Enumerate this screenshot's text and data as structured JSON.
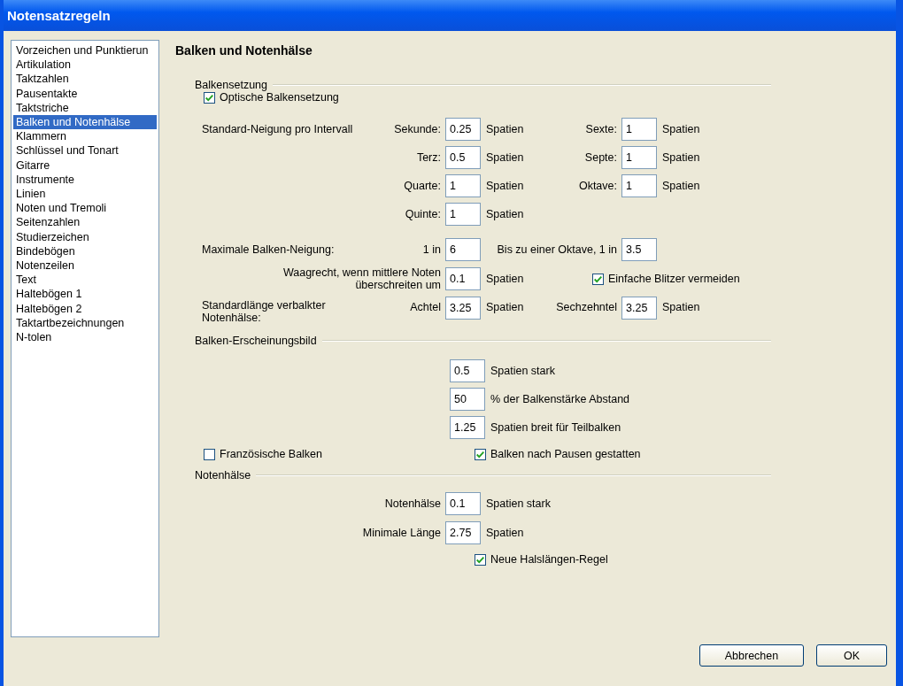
{
  "window": {
    "title": "Notensatzregeln"
  },
  "categories": [
    {
      "label": "Vorzeichen und Punktierun",
      "selected": false
    },
    {
      "label": "Artikulation",
      "selected": false
    },
    {
      "label": "Taktzahlen",
      "selected": false
    },
    {
      "label": "Pausentakte",
      "selected": false
    },
    {
      "label": "Taktstriche",
      "selected": false
    },
    {
      "label": "Balken und Notenhälse",
      "selected": true
    },
    {
      "label": "Klammern",
      "selected": false
    },
    {
      "label": "Schlüssel und Tonart",
      "selected": false
    },
    {
      "label": "Gitarre",
      "selected": false
    },
    {
      "label": "Instrumente",
      "selected": false
    },
    {
      "label": "Linien",
      "selected": false
    },
    {
      "label": "Noten und Tremoli",
      "selected": false
    },
    {
      "label": "Seitenzahlen",
      "selected": false
    },
    {
      "label": "Studierzeichen",
      "selected": false
    },
    {
      "label": "Bindebögen",
      "selected": false
    },
    {
      "label": "Notenzeilen",
      "selected": false
    },
    {
      "label": "Text",
      "selected": false
    },
    {
      "label": "Haltebögen 1",
      "selected": false
    },
    {
      "label": "Haltebögen 2",
      "selected": false
    },
    {
      "label": "Taktartbezeichnungen",
      "selected": false
    },
    {
      "label": "N-tolen",
      "selected": false
    }
  ],
  "page_title": "Balken und Notenhälse",
  "beaming": {
    "title": "Balkensetzung",
    "optical": {
      "label": "Optische Balkensetzung",
      "checked": true
    },
    "slope_label": "Standard-Neigung pro Intervall",
    "intervals_left": [
      {
        "label": "Sekunde:",
        "value": "0.25",
        "unit": "Spatien"
      },
      {
        "label": "Terz:",
        "value": "0.5",
        "unit": "Spatien"
      },
      {
        "label": "Quarte:",
        "value": "1",
        "unit": "Spatien"
      },
      {
        "label": "Quinte:",
        "value": "1",
        "unit": "Spatien"
      }
    ],
    "intervals_right": [
      {
        "label": "Sexte:",
        "value": "1",
        "unit": "Spatien"
      },
      {
        "label": "Septe:",
        "value": "1",
        "unit": "Spatien"
      },
      {
        "label": "Oktave:",
        "value": "1",
        "unit": "Spatien"
      }
    ],
    "max_slope": {
      "label": "Maximale Balken-Neigung:",
      "ratio_label": "1 in",
      "value": "6",
      "octave_label": "Bis zu einer Oktave, 1 in",
      "octave_value": "3.5"
    },
    "horizontal": {
      "label": "Waagrecht, wenn mittlere Noten überschreiten um",
      "value": "0.1",
      "unit": "Spatien"
    },
    "avoid_wedges": {
      "label": "Einfache Blitzer vermeiden",
      "checked": true
    },
    "stem_length": {
      "label": "Standardlänge verbalkter Notenhälse:",
      "eighth_label": "Achtel",
      "eighth_value": "3.25",
      "eighth_unit": "Spatien",
      "sixteenth_label": "Sechzehntel",
      "sixteenth_value": "3.25",
      "sixteenth_unit": "Spatien"
    }
  },
  "appearance": {
    "title": "Balken-Erscheinungsbild",
    "rows": [
      {
        "value": "0.5",
        "unit": "Spatien stark"
      },
      {
        "value": "50",
        "unit": "% der Balkenstärke Abstand"
      },
      {
        "value": "1.25",
        "unit": "Spatien breit für Teilbalken"
      }
    ],
    "french": {
      "label": "Französische Balken",
      "checked": false
    },
    "after_rests": {
      "label": "Balken nach Pausen gestatten",
      "checked": true
    }
  },
  "stems": {
    "title": "Notenhälse",
    "rows": [
      {
        "label": "Notenhälse",
        "value": "0.1",
        "unit": "Spatien stark"
      },
      {
        "label": "Minimale Länge",
        "value": "2.75",
        "unit": "Spatien"
      }
    ],
    "new_rule": {
      "label": "Neue Halslängen-Regel",
      "checked": true
    }
  },
  "buttons": [
    "Abbrechen",
    "OK"
  ]
}
